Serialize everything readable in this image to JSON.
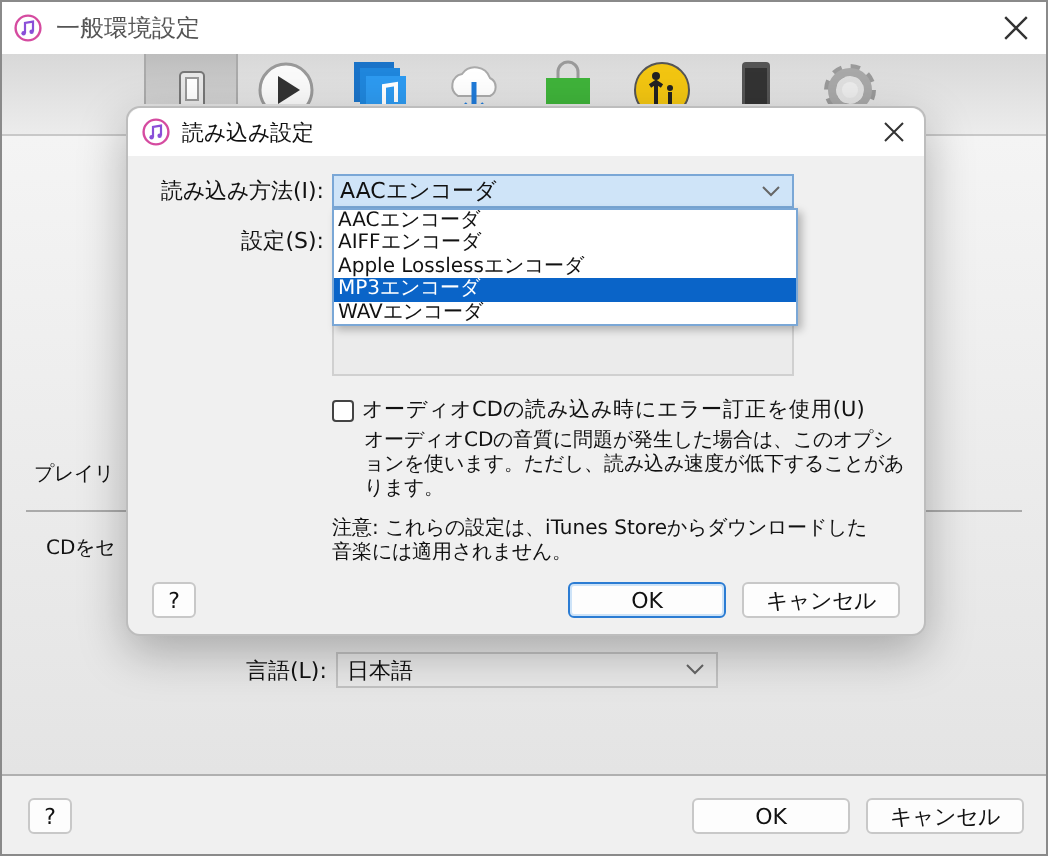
{
  "window": {
    "title": "一般環境設定"
  },
  "toolbar": {
    "tabs": [
      {
        "kind": "general",
        "selected": true
      },
      {
        "kind": "playback",
        "selected": false
      },
      {
        "kind": "sharing",
        "selected": false
      },
      {
        "kind": "download",
        "selected": false
      },
      {
        "kind": "store",
        "selected": false
      },
      {
        "kind": "restrictions",
        "selected": false
      },
      {
        "kind": "devices",
        "selected": false
      },
      {
        "kind": "advanced",
        "selected": false
      }
    ]
  },
  "content": {
    "playlist_label": "プレイリ",
    "cd_label": "CDをセ",
    "language": {
      "label": "言語(L):",
      "value": "日本語"
    }
  },
  "buttons": {
    "help": "?",
    "ok": "OK",
    "cancel": "キャンセル"
  },
  "dialog": {
    "title": "読み込み設定",
    "import_method": {
      "label": "読み込み方法(I):",
      "value": "AACエンコーダ",
      "expanded": true,
      "options": [
        {
          "label": "AACエンコーダ",
          "highlighted": false
        },
        {
          "label": "AIFFエンコーダ",
          "highlighted": false
        },
        {
          "label": "Apple Losslessエンコーダ",
          "highlighted": false
        },
        {
          "label": "MP3エンコーダ",
          "highlighted": true
        },
        {
          "label": "WAVエンコーダ",
          "highlighted": false
        }
      ]
    },
    "settings": {
      "label": "設定(S):"
    },
    "error_correction": {
      "label": "オーディオCDの読み込み時にエラー訂正を使用(U)",
      "checked": false,
      "description": "オーディオCDの音質に問題が発生した場合は、このオプションを使います。ただし、読み込み速度が低下することがあります。"
    },
    "note": "注意: これらの設定は、iTunes Storeからダウンロードした音楽には適用されません。",
    "buttons": {
      "help": "?",
      "ok": "OK",
      "cancel": "キャンセル"
    }
  }
}
